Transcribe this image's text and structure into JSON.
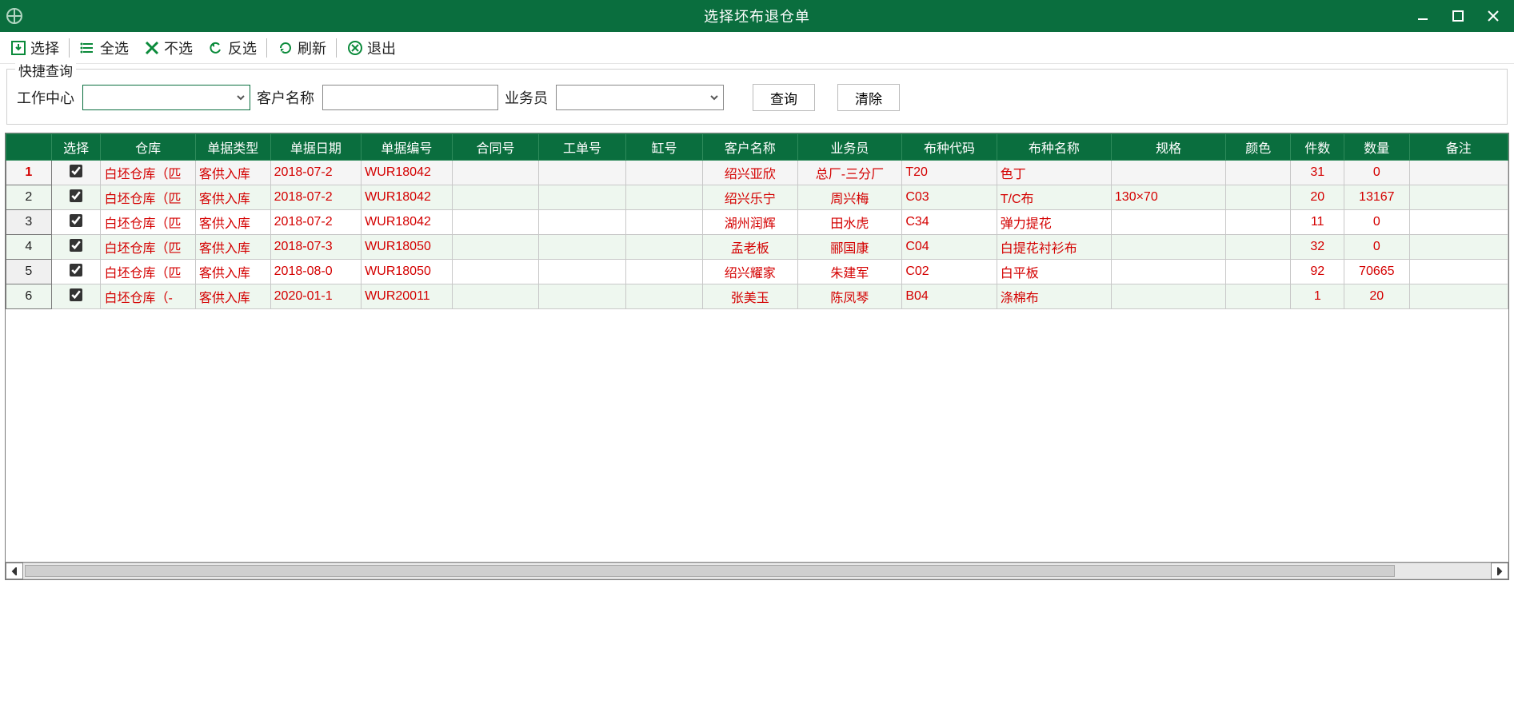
{
  "window": {
    "title": "选择坯布退仓单"
  },
  "toolbar": {
    "select": "选择",
    "select_all": "全选",
    "select_none": "不选",
    "invert": "反选",
    "refresh": "刷新",
    "exit": "退出"
  },
  "query": {
    "legend": "快捷查询",
    "work_center_label": "工作中心",
    "work_center_value": "",
    "customer_label": "客户名称",
    "customer_value": "",
    "salesman_label": "业务员",
    "salesman_value": "",
    "search_btn": "查询",
    "clear_btn": "清除"
  },
  "columns": {
    "select": "选择",
    "warehouse": "仓库",
    "doc_type": "单据类型",
    "doc_date": "单据日期",
    "doc_no": "单据编号",
    "contract_no": "合同号",
    "work_order": "工单号",
    "vat_no": "缸号",
    "customer": "客户名称",
    "salesman": "业务员",
    "cloth_code": "布种代码",
    "cloth_name": "布种名称",
    "spec": "规格",
    "color": "颜色",
    "pieces": "件数",
    "qty": "数量",
    "remark": "备注"
  },
  "rows": [
    {
      "no": "1",
      "checked": true,
      "warehouse": "白坯仓库（匹",
      "doc_type": "客供入库",
      "doc_date": "2018-07-2",
      "doc_no": "WUR18042",
      "contract_no": "",
      "work_order": "",
      "vat_no": "",
      "customer": "绍兴亚欣",
      "salesman": "总厂-三分厂",
      "cloth_code": "T20",
      "cloth_name": "色丁",
      "spec": "",
      "color": "",
      "pieces": "31",
      "qty": "0",
      "remark": ""
    },
    {
      "no": "2",
      "checked": true,
      "warehouse": "白坯仓库（匹",
      "doc_type": "客供入库",
      "doc_date": "2018-07-2",
      "doc_no": "WUR18042",
      "contract_no": "",
      "work_order": "",
      "vat_no": "",
      "customer": "绍兴乐宁",
      "salesman": "周兴梅",
      "cloth_code": "C03",
      "cloth_name": "T/C布",
      "spec": "130×70",
      "color": "",
      "pieces": "20",
      "qty": "13167",
      "remark": ""
    },
    {
      "no": "3",
      "checked": true,
      "warehouse": "白坯仓库（匹",
      "doc_type": "客供入库",
      "doc_date": "2018-07-2",
      "doc_no": "WUR18042",
      "contract_no": "",
      "work_order": "",
      "vat_no": "",
      "customer": "湖州润辉",
      "salesman": "田水虎",
      "cloth_code": "C34",
      "cloth_name": "弹力提花",
      "spec": "",
      "color": "",
      "pieces": "11",
      "qty": "0",
      "remark": ""
    },
    {
      "no": "4",
      "checked": true,
      "warehouse": "白坯仓库（匹",
      "doc_type": "客供入库",
      "doc_date": "2018-07-3",
      "doc_no": "WUR18050",
      "contract_no": "",
      "work_order": "",
      "vat_no": "",
      "customer": "孟老板",
      "salesman": "郦国康",
      "cloth_code": "C04",
      "cloth_name": "白提花衬衫布",
      "spec": "",
      "color": "",
      "pieces": "32",
      "qty": "0",
      "remark": ""
    },
    {
      "no": "5",
      "checked": true,
      "warehouse": "白坯仓库（匹",
      "doc_type": "客供入库",
      "doc_date": "2018-08-0",
      "doc_no": "WUR18050",
      "contract_no": "",
      "work_order": "",
      "vat_no": "",
      "customer": "绍兴耀家",
      "salesman": "朱建军",
      "cloth_code": "C02",
      "cloth_name": "白平板",
      "spec": "",
      "color": "",
      "pieces": "92",
      "qty": "70665",
      "remark": ""
    },
    {
      "no": "6",
      "checked": true,
      "warehouse": "白坯仓库（-",
      "doc_type": "客供入库",
      "doc_date": "2020-01-1",
      "doc_no": "WUR20011",
      "contract_no": "",
      "work_order": "",
      "vat_no": "",
      "customer": "张美玉",
      "salesman": "陈凤琴",
      "cloth_code": "B04",
      "cloth_name": "涤棉布",
      "spec": "",
      "color": "",
      "pieces": "1",
      "qty": "20",
      "remark": ""
    }
  ]
}
